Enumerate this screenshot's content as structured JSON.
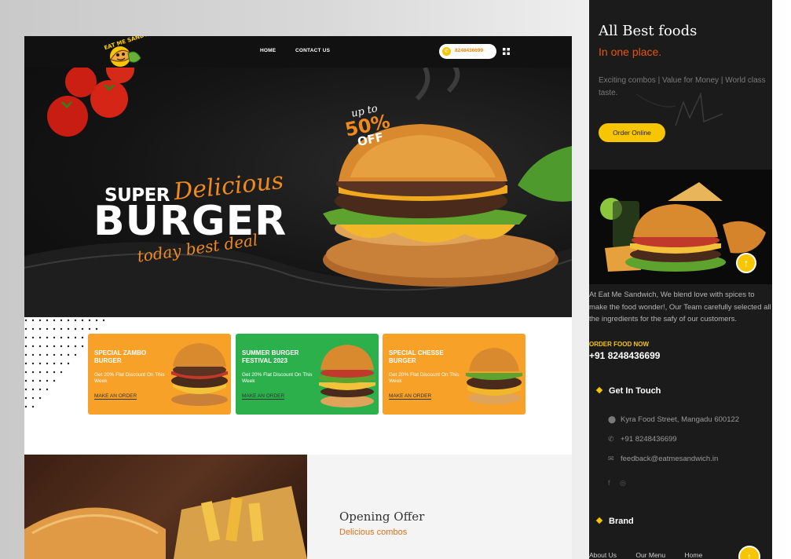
{
  "nav": {
    "logo_text": "EAT ME SANDWICH",
    "links": [
      "HOME",
      "CONTACT US"
    ],
    "phone": "8248436699"
  },
  "hero": {
    "badge_upto": "up to",
    "badge_percent": "50%",
    "badge_off": "OFF",
    "super": "SUPER",
    "delicious": "Delicious",
    "burger": "BURGER",
    "deal": "today best deal"
  },
  "promos": [
    {
      "title": "SPECIAL ZAMBO BURGER",
      "desc": "Get 20% Flat Discount On This Week",
      "link": "MAKE AN ORDER"
    },
    {
      "title": "SUMMER BURGER FESTIVAL 2023",
      "desc": "Get 20% Flat Discount On This Week",
      "link": "MAKE AN ORDER"
    },
    {
      "title": "SPECIAL CHESSE BURGER",
      "desc": "Get 20% Flat Discount On This Week",
      "link": "MAKE AN ORDER"
    }
  ],
  "opening": {
    "title": "Opening Offer",
    "subtitle": "Delicious combos"
  },
  "sidebar": {
    "title": "All Best foods",
    "subtitle": "In one place.",
    "description": "Exciting combos | Value for Money | World class taste.",
    "order_button": "Order Online",
    "about": "At Eat Me Sandwich, We blend love with spices to make the food wonder!, Our Team carefully selected all the ingredients for the safy of our customers.",
    "order_label": "ORDER FOOD NOW",
    "order_phone": "+91 8248436699",
    "get_in_touch": "Get In Touch",
    "address": "Kyra Food Street, Mangadu 600122",
    "phone": "+91 8248436699",
    "email": "feedback@eatmesandwich.in",
    "social_icons": [
      "facebook-icon",
      "instagram-icon"
    ],
    "brand": "Brand",
    "footer_links": [
      "About Us",
      "Our Menu",
      "Home"
    ]
  },
  "colors": {
    "accent_orange": "#f08a1c",
    "accent_yellow": "#f7c600",
    "promo_orange": "#f7a128",
    "promo_green": "#2bb04b",
    "dark_bg": "#1b1b1b"
  }
}
